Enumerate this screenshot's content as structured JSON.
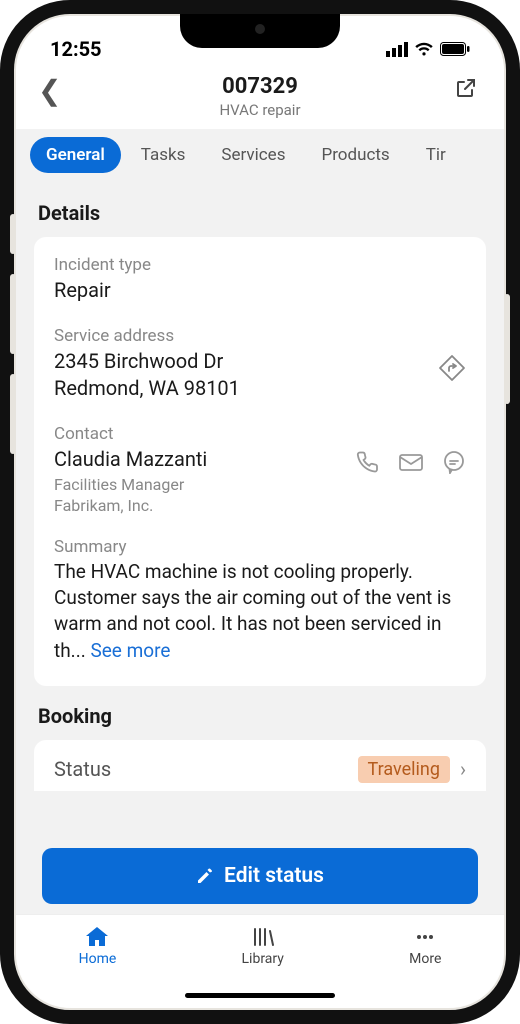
{
  "status": {
    "time": "12:55"
  },
  "header": {
    "title": "007329",
    "subtitle": "HVAC repair"
  },
  "tabs": [
    "General",
    "Tasks",
    "Services",
    "Products",
    "Tir"
  ],
  "details": {
    "heading": "Details",
    "incident_label": "Incident type",
    "incident_value": "Repair",
    "address_label": "Service address",
    "address_line1": "2345 Birchwood Dr",
    "address_line2": "Redmond, WA 98101",
    "contact_label": "Contact",
    "contact_name": "Claudia Mazzanti",
    "contact_role": "Facilities Manager",
    "contact_company": "Fabrikam, Inc.",
    "summary_label": "Summary",
    "summary_text": "The HVAC machine is not cooling properly. Customer says the air coming out of the vent is warm and not cool. It has not been serviced in th... ",
    "see_more": "See more"
  },
  "booking": {
    "heading": "Booking",
    "status_label": "Status",
    "status_value": "Traveling"
  },
  "edit_button": "Edit status",
  "nav": {
    "home": "Home",
    "library": "Library",
    "more": "More"
  }
}
